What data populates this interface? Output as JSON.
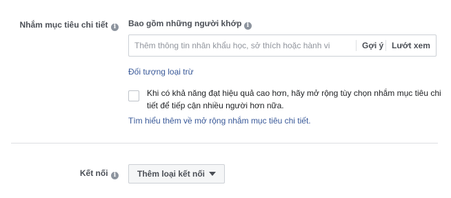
{
  "detailed_targeting": {
    "label": "Nhắm mục tiêu chi tiết",
    "label_icon": "info-icon",
    "include_title": "Bao gồm những người khớp",
    "include_icon": "info-icon",
    "search_placeholder": "Thêm thông tin nhân khẩu học, sở thích hoặc hành vi",
    "search_value": "",
    "suggestions_label": "Gợi ý",
    "browse_label": "Lướt xem",
    "exclude_link": "Đối tượng loại trừ",
    "expand_checkbox_checked": false,
    "expand_text": "Khi có khả năng đạt hiệu quả cao hơn, hãy mở rộng tùy chọn nhắm mục tiêu chi tiết để tiếp cận nhiều người hơn nữa.",
    "learn_more_link": "Tìm hiểu thêm về mở rộng nhắm mục tiêu chi tiết."
  },
  "connections": {
    "label": "Kết nối",
    "label_icon": "info-icon",
    "add_button_label": "Thêm loại kết nối"
  }
}
